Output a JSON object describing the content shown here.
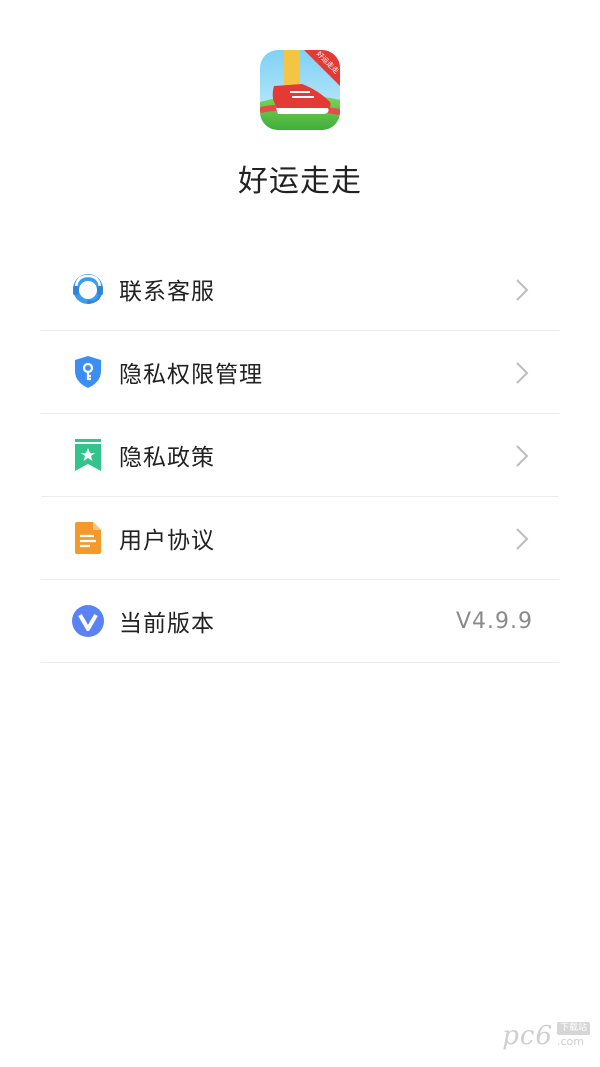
{
  "app": {
    "name": "好运走走",
    "icon_badge": "好运走走"
  },
  "menu": {
    "items": [
      {
        "label": "联系客服",
        "icon": "headset-icon"
      },
      {
        "label": "隐私权限管理",
        "icon": "shield-key-icon"
      },
      {
        "label": "隐私政策",
        "icon": "bookmark-star-icon"
      },
      {
        "label": "用户协议",
        "icon": "document-icon"
      },
      {
        "label": "当前版本",
        "icon": "version-v-icon",
        "value": "V4.9.9"
      }
    ]
  },
  "watermark": {
    "logo": "pc6",
    "tag": "下载站",
    "domain": ".com"
  },
  "colors": {
    "headset": "#3d9cf0",
    "shield": "#3b8ef2",
    "bookmark": "#31c48d",
    "document": "#f49a2d",
    "version": "#5b82f5"
  }
}
